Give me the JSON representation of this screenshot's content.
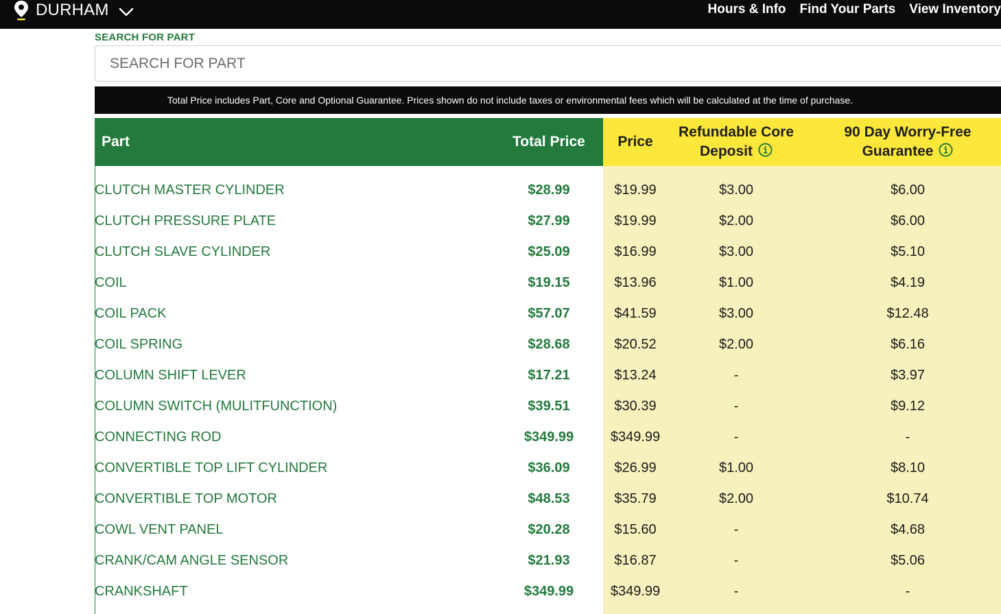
{
  "topbar": {
    "location": "DURHAM",
    "nav": [
      "Hours & Info",
      "Find Your Parts",
      "View Inventory"
    ]
  },
  "search": {
    "label": "SEARCH FOR PART",
    "placeholder": "SEARCH FOR PART"
  },
  "notice": "Total Price includes Part, Core and Optional Guarantee. Prices shown do not include taxes or environmental fees which will be calculated at the time of purchase.",
  "table": {
    "headers": {
      "part": "Part",
      "total": "Total Price",
      "price": "Price",
      "core_line1": "Refundable Core",
      "core_line2": "Deposit",
      "guarantee_line1": "90 Day Worry-Free",
      "guarantee_line2": "Guarantee"
    },
    "rows": [
      {
        "part": "CLUTCH MASTER CYLINDER",
        "total": "$28.99",
        "price": "$19.99",
        "core": "$3.00",
        "guarantee": "$6.00"
      },
      {
        "part": "CLUTCH PRESSURE PLATE",
        "total": "$27.99",
        "price": "$19.99",
        "core": "$2.00",
        "guarantee": "$6.00"
      },
      {
        "part": "CLUTCH SLAVE CYLINDER",
        "total": "$25.09",
        "price": "$16.99",
        "core": "$3.00",
        "guarantee": "$5.10"
      },
      {
        "part": "COIL",
        "total": "$19.15",
        "price": "$13.96",
        "core": "$1.00",
        "guarantee": "$4.19"
      },
      {
        "part": "COIL PACK",
        "total": "$57.07",
        "price": "$41.59",
        "core": "$3.00",
        "guarantee": "$12.48"
      },
      {
        "part": "COIL SPRING",
        "total": "$28.68",
        "price": "$20.52",
        "core": "$2.00",
        "guarantee": "$6.16"
      },
      {
        "part": "COLUMN SHIFT LEVER",
        "total": "$17.21",
        "price": "$13.24",
        "core": "-",
        "guarantee": "$3.97"
      },
      {
        "part": "COLUMN SWITCH (MULITFUNCTION)",
        "total": "$39.51",
        "price": "$30.39",
        "core": "-",
        "guarantee": "$9.12"
      },
      {
        "part": "CONNECTING ROD",
        "total": "$349.99",
        "price": "$349.99",
        "core": "-",
        "guarantee": "-"
      },
      {
        "part": "CONVERTIBLE TOP LIFT CYLINDER",
        "total": "$36.09",
        "price": "$26.99",
        "core": "$1.00",
        "guarantee": "$8.10"
      },
      {
        "part": "CONVERTIBLE TOP MOTOR",
        "total": "$48.53",
        "price": "$35.79",
        "core": "$2.00",
        "guarantee": "$10.74"
      },
      {
        "part": "COWL VENT PANEL",
        "total": "$20.28",
        "price": "$15.60",
        "core": "-",
        "guarantee": "$4.68"
      },
      {
        "part": "CRANK/CAM ANGLE SENSOR",
        "total": "$21.93",
        "price": "$16.87",
        "core": "-",
        "guarantee": "$5.06"
      },
      {
        "part": "CRANKSHAFT",
        "total": "$349.99",
        "price": "$349.99",
        "core": "-",
        "guarantee": "-"
      }
    ]
  },
  "colors": {
    "brand_green": "#237a3c",
    "header_yellow": "#fce83a",
    "body_yellow": "#f7f2bd",
    "bar_black": "#0b0b0b"
  }
}
